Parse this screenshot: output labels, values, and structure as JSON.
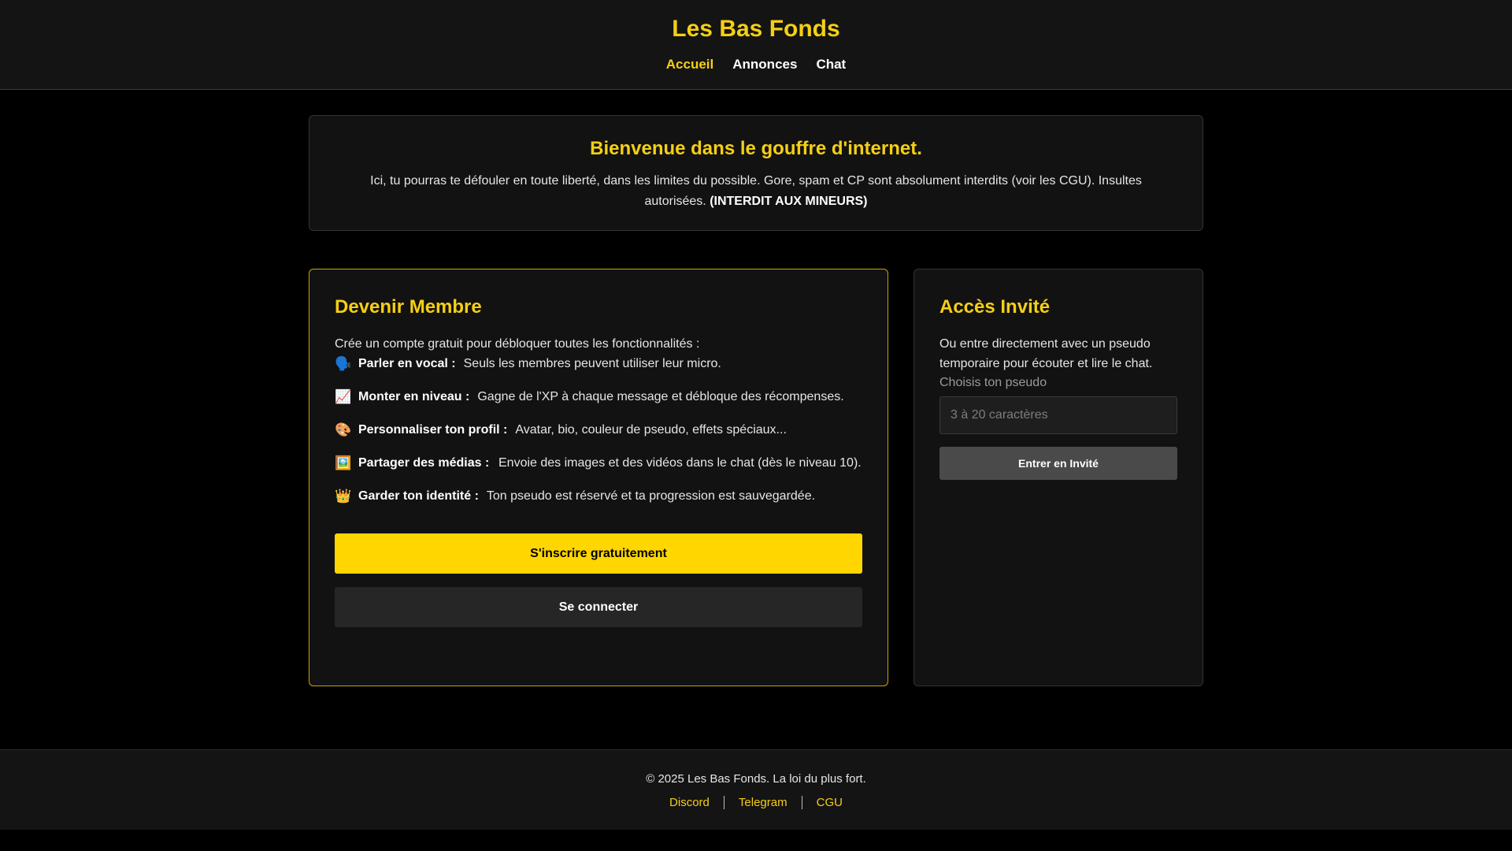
{
  "header": {
    "title": "Les Bas Fonds",
    "nav": [
      {
        "label": "Accueil",
        "active": true
      },
      {
        "label": "Annonces",
        "active": false
      },
      {
        "label": "Chat",
        "active": false
      }
    ]
  },
  "welcome": {
    "title": "Bienvenue dans le gouffre d'internet.",
    "text": "Ici, tu pourras te défouler en toute liberté, dans les limites du possible. Gore, spam et CP sont absolument interdits (voir les CGU). Insultes autorisées.",
    "warning": "(INTERDIT AUX MINEURS)"
  },
  "member": {
    "title": "Devenir Membre",
    "intro": "Crée un compte gratuit pour débloquer toutes les fonctionnalités :",
    "features": [
      {
        "icon": "speaking-head-icon",
        "emoji": "🗣️",
        "label": "Parler en vocal :",
        "desc": "Seuls les membres peuvent utiliser leur micro."
      },
      {
        "icon": "chart-increasing-icon",
        "emoji": "📈",
        "label": "Monter en niveau :",
        "desc": "Gagne de l'XP à chaque message et débloque des récompenses."
      },
      {
        "icon": "palette-icon",
        "emoji": "🎨",
        "label": "Personnaliser ton profil :",
        "desc": "Avatar, bio, couleur de pseudo, effets spéciaux..."
      },
      {
        "icon": "framed-picture-icon",
        "emoji": "🖼️",
        "label": "Partager des médias :",
        "desc": "Envoie des images et des vidéos dans le chat (dès le niveau 10)."
      },
      {
        "icon": "crown-icon",
        "emoji": "👑",
        "label": "Garder ton identité :",
        "desc": "Ton pseudo est réservé et ta progression est sauvegardée."
      }
    ],
    "signup_label": "S'inscrire gratuitement",
    "login_label": "Se connecter"
  },
  "guest": {
    "title": "Accès Invité",
    "intro": "Ou entre directement avec un pseudo temporaire pour écouter et lire le chat.",
    "field_label": "Choisis ton pseudo",
    "placeholder": "3 à 20 caractères",
    "value": "",
    "button_label": "Entrer en Invité"
  },
  "footer": {
    "copyright": "© 2025 Les Bas Fonds. La loi du plus fort.",
    "links": [
      "Discord",
      "Telegram",
      "CGU"
    ]
  },
  "colors": {
    "accent": "#f5cf14",
    "primary_button": "#ffd600",
    "background": "#000000",
    "panel": "#121212"
  }
}
